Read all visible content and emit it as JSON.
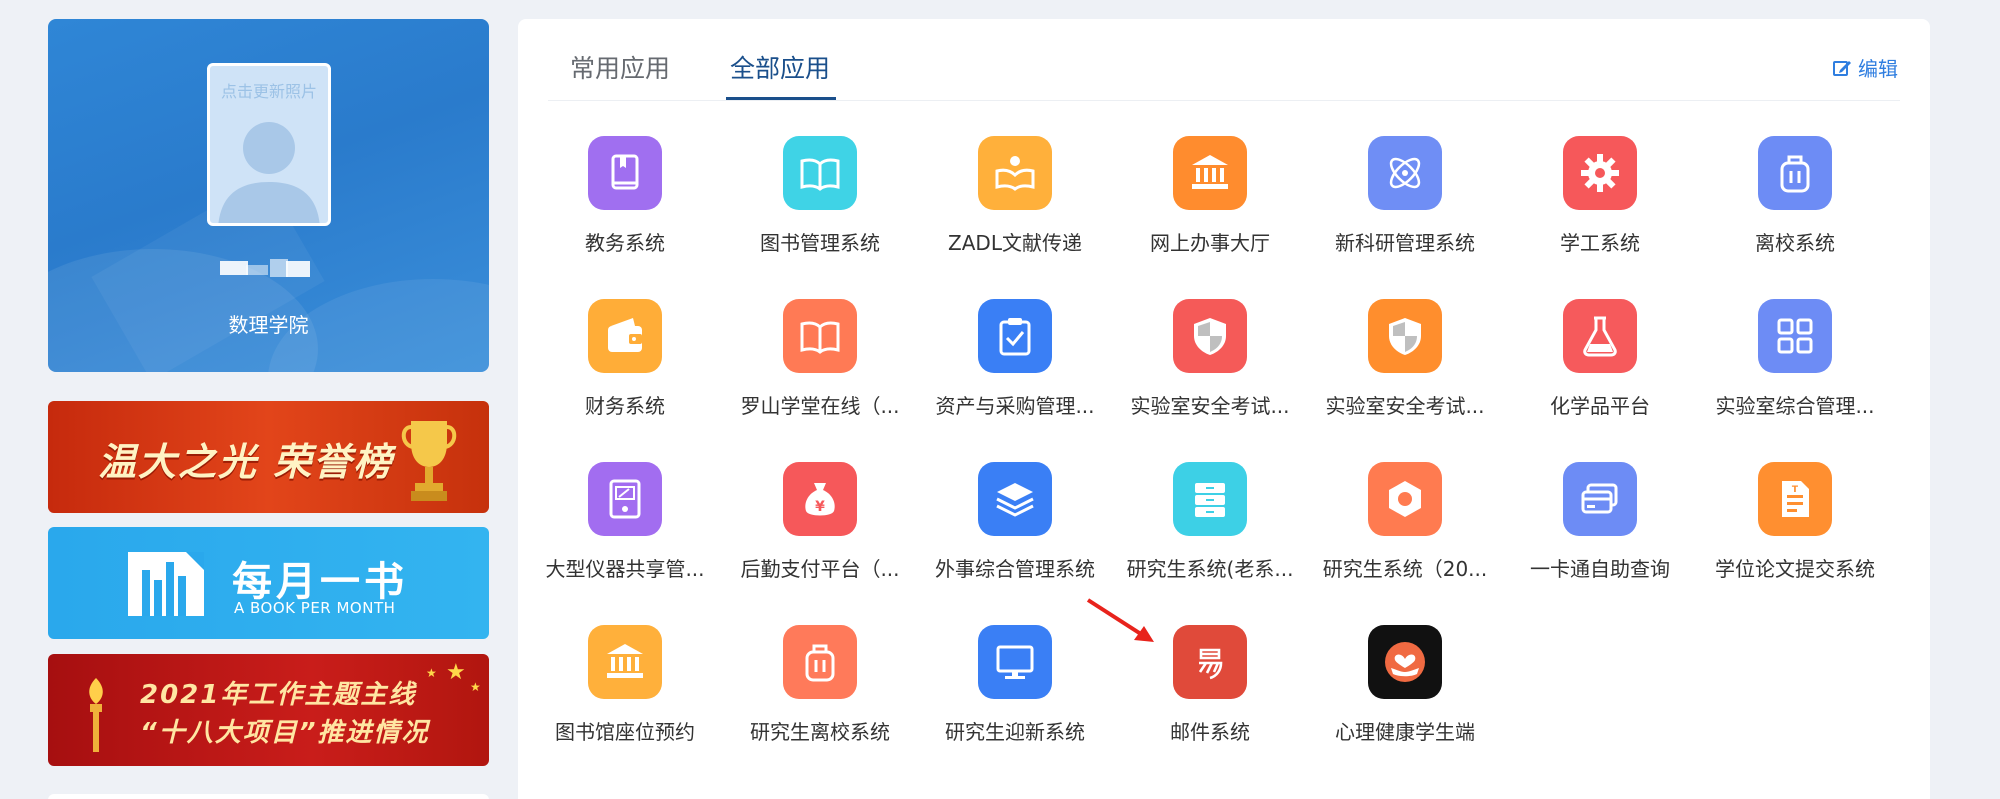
{
  "profile": {
    "photo_hint": "点击更新照片",
    "department": "数理学院"
  },
  "banners": {
    "honor": {
      "title": "温大之光 荣誉榜"
    },
    "book": {
      "title_cn": "每月一书",
      "title_en": "A BOOK PER MONTH"
    },
    "work": {
      "line1": "2021年工作主题主线",
      "line2": "“十八大项目”推进情况"
    }
  },
  "tabs": {
    "common": "常用应用",
    "all": "全部应用",
    "active": "all"
  },
  "edit_label": "编辑",
  "apps": [
    {
      "label": "教务系统",
      "icon": "book-icon",
      "color": "#a06ff0"
    },
    {
      "label": "图书管理系统",
      "icon": "open-book-icon",
      "color": "#3fd3e6"
    },
    {
      "label": "ZADL文献传递",
      "icon": "reading-icon",
      "color": "#ffb03b"
    },
    {
      "label": "网上办事大厅",
      "icon": "bank-icon",
      "color": "#ff8c2e"
    },
    {
      "label": "新科研管理系统",
      "icon": "atom-icon",
      "color": "#6f8ef5"
    },
    {
      "label": "学工系统",
      "icon": "gear-icon",
      "color": "#f6585a"
    },
    {
      "label": "离校系统",
      "icon": "luggage-icon",
      "color": "#6d8cf5"
    },
    {
      "label": "财务系统",
      "icon": "wallet-icon",
      "color": "#ffad38"
    },
    {
      "label": "罗山学堂在线（...",
      "icon": "open-book-icon",
      "color": "#ff7a55"
    },
    {
      "label": "资产与采购管理...",
      "icon": "clipboard-check-icon",
      "color": "#3a7ff5"
    },
    {
      "label": "实验室安全考试...",
      "icon": "shield-icon",
      "color": "#f55a58"
    },
    {
      "label": "实验室安全考试...",
      "icon": "shield-icon",
      "color": "#ff8e2d"
    },
    {
      "label": "化学品平台",
      "icon": "flask-icon",
      "color": "#f65a5c"
    },
    {
      "label": "实验室综合管理...",
      "icon": "grid-icon",
      "color": "#6d8cf5"
    },
    {
      "label": "大型仪器共享管...",
      "icon": "instrument-icon",
      "color": "#a26df0"
    },
    {
      "label": "后勤支付平台（...",
      "icon": "money-bag-icon",
      "color": "#f6585a"
    },
    {
      "label": "外事综合管理系统",
      "icon": "layers-icon",
      "color": "#3a7ff5"
    },
    {
      "label": "研究生系统(老系...",
      "icon": "cabinet-icon",
      "color": "#3dd0e6"
    },
    {
      "label": "研究生系统（20...",
      "icon": "hexagon-icon",
      "color": "#ff7b50"
    },
    {
      "label": "一卡通自助查询",
      "icon": "cards-icon",
      "color": "#6d8cf5"
    },
    {
      "label": "学位论文提交系统",
      "icon": "document-icon",
      "color": "#ff8f30"
    },
    {
      "label": "图书馆座位预约",
      "icon": "bank-icon",
      "color": "#ffb03b"
    },
    {
      "label": "研究生离校系统",
      "icon": "luggage-icon",
      "color": "#ff7a5a"
    },
    {
      "label": "研究生迎新系统",
      "icon": "monitor-icon",
      "color": "#3a7ff5"
    },
    {
      "label": "邮件系统",
      "icon": "mail-yi-icon",
      "color": "#e04a3a"
    },
    {
      "label": "心理健康学生端",
      "icon": "heart-hand-icon",
      "color": "#111111"
    }
  ]
}
